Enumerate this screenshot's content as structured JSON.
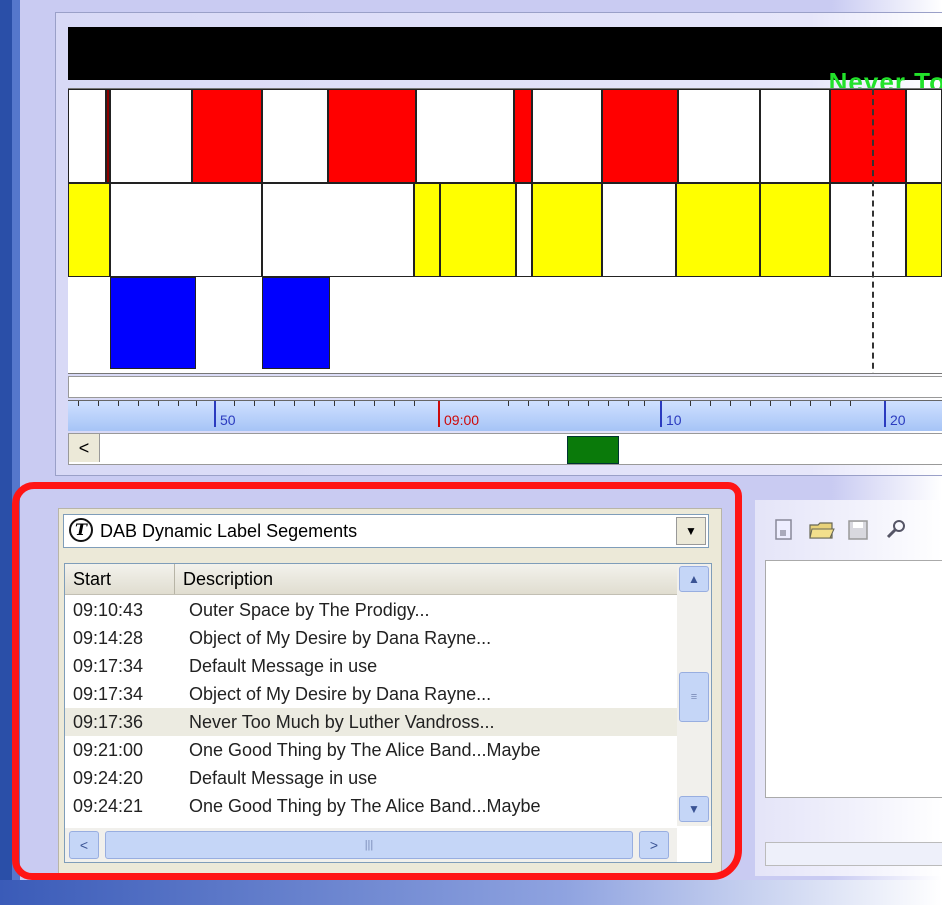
{
  "now_playing": {
    "text": "Never To"
  },
  "timeline": {
    "ruler_labels": [
      "50",
      "09:00",
      "10",
      "20"
    ],
    "scroll_left": "<"
  },
  "dab_panel": {
    "title": "DAB Dynamic Label Segements",
    "logo": "T",
    "dropdown_arrow": "▼",
    "columns": [
      "Start",
      "Description"
    ],
    "rows": [
      {
        "start": "09:10:43",
        "description": "Outer Space by The Prodigy..."
      },
      {
        "start": "09:14:28",
        "description": "Object of My Desire by Dana Rayne..."
      },
      {
        "start": "09:17:34",
        "description": "Default Message in use"
      },
      {
        "start": "09:17:34",
        "description": "Object of My Desire by Dana Rayne..."
      },
      {
        "start": "09:17:36",
        "description": "Never Too Much by Luther Vandross..."
      },
      {
        "start": "09:21:00",
        "description": "One Good Thing by The Alice Band...Maybe"
      },
      {
        "start": "09:24:20",
        "description": "Default Message in use"
      },
      {
        "start": "09:24:21",
        "description": "One Good Thing by The Alice Band...Maybe"
      }
    ],
    "selected_row": 4,
    "scroll": {
      "up": "▲",
      "down": "▼",
      "left": "<",
      "right": ">",
      "grip": "|||",
      "vgrip": "≡"
    }
  },
  "colors": {
    "accent_red": "#ff0000",
    "accent_yellow": "#ffff00",
    "accent_blue": "#0000ff",
    "now_text": "#22e22a",
    "highlight": "#ff1515"
  },
  "toolbar_icons": [
    "new-document-icon",
    "open-folder-icon",
    "save-icon",
    "search-icon"
  ]
}
